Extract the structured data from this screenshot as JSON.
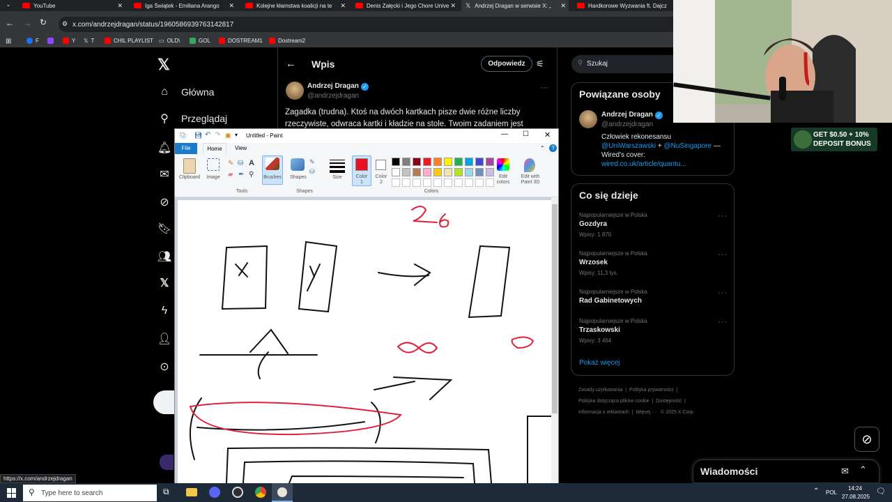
{
  "browser": {
    "tabs": [
      {
        "title": "YouTube"
      },
      {
        "title": "Iga Świątek - Emiliana Arango |"
      },
      {
        "title": "Kolejne kłamstwa koalicji na te"
      },
      {
        "title": "Denis Załęcki i Jego Chore Unive"
      },
      {
        "title": "Andrzej Dragan w serwisie X: „"
      },
      {
        "title": "Hardkorowe Wyzwania ft. Dajcz"
      }
    ],
    "url": "x.com/andrzejdragan/status/1960586939763142817",
    "bookmarks": [
      "F",
      "Y",
      "T",
      "CHIL PLAYLIST",
      "OLD\\",
      "GOL",
      "DOSTREAM1",
      "Dostream2"
    ],
    "status_url": "https://x.com/andrzejdragan"
  },
  "x": {
    "nav": [
      "Główna",
      "Przeglądaj"
    ],
    "header_title": "Wpis",
    "reply_button": "Odpowiedz",
    "author_name": "Andrzej Dragan",
    "author_handle": "@andrzejdragan",
    "tweet_line1": "Zagadka (trudna). Ktoś na dwóch kartkach pisze dwie różne liczby",
    "tweet_line2": "rzeczywiste, odwraca kartki i kładzie na stole. Twoim zadaniem jest",
    "search_placeholder": "Szukaj",
    "related": {
      "title": "Powiązane osoby",
      "name": "Andrzej Dragan",
      "handle": "@andrzejdragan",
      "bio1": "Człowiek rekonesansu",
      "bio_link1": "@UniWarszawski",
      "bio_plus": "+",
      "bio_link2": "@NuSingapore",
      "bio_dash": "—",
      "bio2": "Wired's cover:",
      "bio_link3": "wired.co.uk/article/quantu..."
    },
    "trends": {
      "title": "Co się dzieje",
      "items": [
        {
          "category": "Najpopularniejsze w Polska",
          "name": "Gozdyra",
          "count": "Wpisy: 1 870"
        },
        {
          "category": "Najpopularniejsze w Polska",
          "name": "Wrzosek",
          "count": "Wpisy: 11,3 tys."
        },
        {
          "category": "Najpopularniejsze w Polska",
          "name": "Rad Gabinetowych",
          "count": ""
        },
        {
          "category": "Najpopularniejsze w Polska",
          "name": "Trzaskowski",
          "count": "Wpisy: 3 464"
        }
      ],
      "show_more": "Pokaż więcej"
    },
    "footer": {
      "l1a": "Zasady użytkowania",
      "l1b": "Polityka prywatności",
      "l2a": "Polityka dotycząca plików cookie",
      "l2b": "Dostępność",
      "l3a": "Informacja o reklamach",
      "l3b": "Więcej ···",
      "l3c": "© 2025 X Corp."
    },
    "messages_title": "Wiadomości"
  },
  "paint": {
    "title": "Untitled - Paint",
    "tabs": [
      "File",
      "Home",
      "View"
    ],
    "groups": {
      "clipboard": "Clipboard",
      "image": "Image",
      "tools": "Tools",
      "brushes": "Brushes",
      "shapes": "Shapes",
      "shapes_group": "Shapes",
      "size": "Size",
      "color1": "Color\n1",
      "color2": "Color\n2",
      "colors": "Colors",
      "edit_colors": "Edit\ncolors",
      "edit_3d": "Edit with\nPaint 3D"
    },
    "palette": [
      "#000000",
      "#7f7f7f",
      "#880015",
      "#ed1c24",
      "#ff7f27",
      "#fff200",
      "#22b14c",
      "#00a2e8",
      "#3f48cc",
      "#a349a4",
      "#ffffff",
      "#c3c3c3",
      "#b97a57",
      "#ffaec9",
      "#ffc90e",
      "#efe4b0",
      "#b5e61d",
      "#99d9ea",
      "#7092be",
      "#c8bfe7"
    ],
    "color1": "#e81123",
    "drawing_text": "26"
  },
  "taskbar": {
    "search_placeholder": "Type here to search",
    "lang": "POL",
    "time": "14:24",
    "date": "27.08.2025"
  },
  "ad": {
    "line1": "GET $0.50 + 10%",
    "line2": "DEPOSIT BONUS"
  }
}
